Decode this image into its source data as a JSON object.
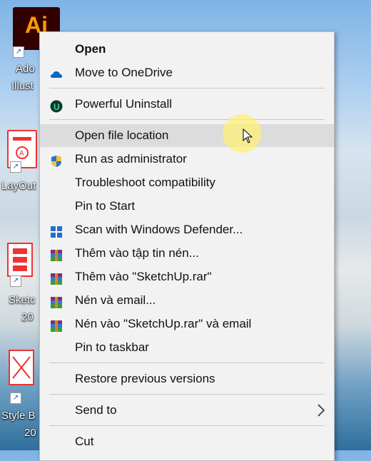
{
  "desktop": {
    "icons": [
      {
        "label": "Ado\nIllust",
        "line1": "Ado",
        "line2": "Illust",
        "tile_text": "Ai",
        "icon": "illustrator-icon"
      },
      {
        "label": "LayOut",
        "line1": "LayOut",
        "line2": "",
        "icon": "layout-icon"
      },
      {
        "label": "Sketc\n20",
        "line1": "Sketc",
        "line2": "20",
        "icon": "sketchup-icon"
      },
      {
        "label": "Style B\n20",
        "line1": "Style B",
        "line2": "20",
        "icon": "style-builder-icon"
      }
    ]
  },
  "menu": {
    "items": [
      {
        "label": "Open",
        "bold": true,
        "icon": ""
      },
      {
        "label": "Move to OneDrive",
        "icon": "onedrive-icon"
      },
      {
        "label": "Powerful Uninstall",
        "icon": "uninstall-icon"
      },
      {
        "label": "Open file location",
        "icon": "",
        "hovered": true
      },
      {
        "label": "Run as administrator",
        "icon": "uac-shield-icon"
      },
      {
        "label": "Troubleshoot compatibility",
        "icon": ""
      },
      {
        "label": "Pin to Start",
        "icon": ""
      },
      {
        "label": "Scan with Windows Defender...",
        "icon": "defender-icon"
      },
      {
        "label": "Thêm vào tập tin nén...",
        "icon": "winrar-icon"
      },
      {
        "label": "Thêm vào \"SketchUp.rar\"",
        "icon": "winrar-icon"
      },
      {
        "label": "Nén và email...",
        "icon": "winrar-icon"
      },
      {
        "label": "Nén vào \"SketchUp.rar\" và email",
        "icon": "winrar-icon"
      },
      {
        "label": "Pin to taskbar",
        "icon": ""
      },
      {
        "label": "Restore previous versions",
        "icon": ""
      },
      {
        "label": "Send to",
        "icon": "",
        "submenu": true
      },
      {
        "label": "Cut",
        "icon": ""
      }
    ]
  },
  "colors": {
    "menu_bg": "#f2f2f2",
    "hover_bg": "#dcdcdc",
    "accent_blue": "#0a64c8"
  }
}
